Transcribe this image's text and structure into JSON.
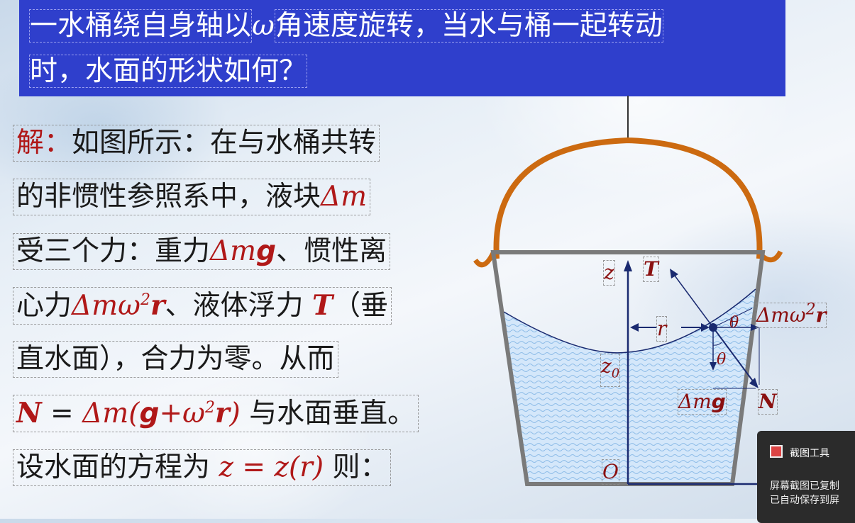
{
  "question": {
    "line1_a": "一水桶绕自身轴以",
    "omega": "ω",
    "line1_b": "角速度旋转，当水与桶一起转动",
    "line2": "时，水面的形状如何？"
  },
  "solution": {
    "l1_prefix": "解",
    "l1_colon": "：",
    "l1_text": "如图所示：在与水桶共转",
    "l2_text": "的非惯性参照系中，液块",
    "l2_dm": "Δm",
    "l3_text": "受三个力：重力",
    "l3_dm": "Δm",
    "l3_g": "g",
    "l3_tail": "、惯性离",
    "l4_text": "心力",
    "l4_dmw": "Δmω",
    "l4_sup": "2",
    "l4_r": "r",
    "l4_mid": "、液体浮力 ",
    "l4_T": "T",
    "l4_tail": "（垂",
    "l5_text": "直水面），合力为零。从而",
    "l6_N": "N",
    "l6_eq": " = ",
    "l6_dm": "Δm(",
    "l6_g": "g",
    "l6_plus": "+",
    "l6_w": "ω",
    "l6_sup": "2",
    "l6_r": "r",
    "l6_close": ")",
    "l6_tail": " 与水面垂直。",
    "l7_text": "设水面的方程为 ",
    "l7_eq": "z = z(r)",
    "l7_tail": " 则："
  },
  "diagram": {
    "label_z": "z",
    "label_T": "T",
    "label_r": "r",
    "label_theta1": "θ",
    "label_centrifugal": "Δmω",
    "label_centrifugal_sup": "2",
    "label_centrifugal_r": "r",
    "label_theta2": "θ",
    "label_z0": "z",
    "label_z0_sub": "0",
    "label_dmg": "Δm",
    "label_dmg_g": "g",
    "label_N": "N",
    "label_O": "O"
  },
  "toast": {
    "title": "截图工具",
    "message_line1": "屏幕截图已复制",
    "message_line2": "已自动保存到屏"
  },
  "colors": {
    "title_bg": "#2f3fcc",
    "handle": "#cc6a10",
    "bucket": "#7a7a7a",
    "water": "#a9cdf0",
    "accent_red": "#b01818"
  }
}
